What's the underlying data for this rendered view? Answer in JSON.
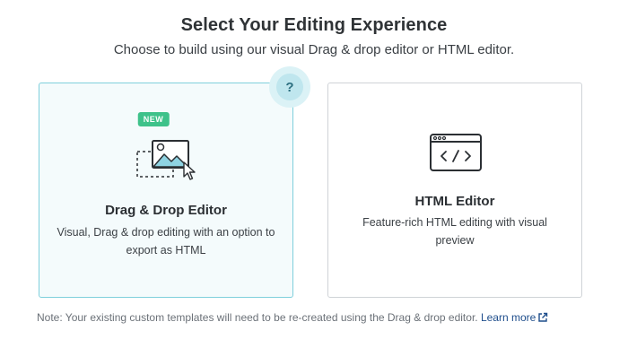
{
  "header": {
    "title": "Select Your Editing Experience",
    "subtitle": "Choose to build using our visual Drag & drop editor or HTML editor."
  },
  "help": {
    "label": "?",
    "icon": "help-icon"
  },
  "cards": {
    "drag_drop": {
      "badge": "NEW",
      "title": "Drag & Drop Editor",
      "description": "Visual, Drag & drop editing with an option to export as HTML",
      "icon": "image-drag-icon",
      "selected": true
    },
    "html": {
      "title": "HTML Editor",
      "description": "Feature-rich HTML editing with visual preview",
      "icon": "code-window-icon",
      "selected": false
    }
  },
  "footer": {
    "note": "Note: Your existing custom templates will need to be re-created using the Drag & drop editor.",
    "link_label": "Learn more",
    "link_icon": "external-link-icon"
  },
  "colors": {
    "selected_border": "#7fd0dc",
    "selected_bg": "#f4fbfc",
    "badge": "#3ec28a",
    "link": "#1f4e8c",
    "help_bg": "#dbf2f6"
  }
}
